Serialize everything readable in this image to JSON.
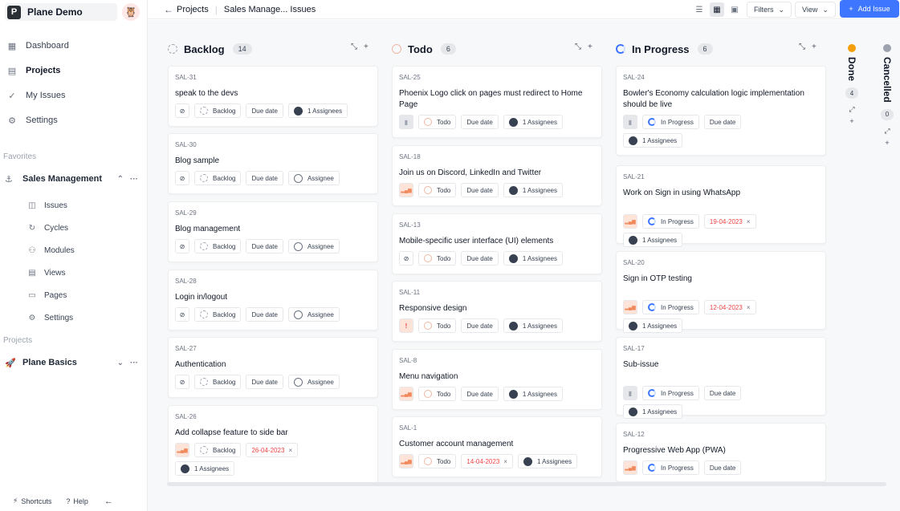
{
  "workspace": {
    "logo_letter": "P",
    "name": "Plane Demo",
    "user_avatar": "🦉"
  },
  "nav": [
    {
      "label": "Dashboard",
      "icon": "grid-icon",
      "glyph": "▦"
    },
    {
      "label": "Projects",
      "icon": "projects-icon",
      "glyph": "▤"
    },
    {
      "label": "My Issues",
      "icon": "check-circle-icon",
      "glyph": "✓"
    },
    {
      "label": "Settings",
      "icon": "gear-icon",
      "glyph": "⚙"
    }
  ],
  "favorites_label": "Favorites",
  "favorite_project": {
    "name": "Sales Management",
    "glyph": "⚓",
    "chevron": "⌃",
    "more": "···"
  },
  "sub_nav": [
    {
      "label": "Issues",
      "glyph": "◫",
      "icon": "layers-icon"
    },
    {
      "label": "Cycles",
      "glyph": "↻",
      "icon": "cycle-icon"
    },
    {
      "label": "Modules",
      "glyph": "⚇",
      "icon": "modules-icon"
    },
    {
      "label": "Views",
      "glyph": "▤",
      "icon": "views-icon"
    },
    {
      "label": "Pages",
      "glyph": "▭",
      "icon": "pages-icon"
    },
    {
      "label": "Settings",
      "glyph": "⚙",
      "icon": "gear-icon"
    }
  ],
  "projects_label": "Projects",
  "other_project": {
    "name": "Plane Basics",
    "glyph": "🚀",
    "chevron": "⌄",
    "more": "···"
  },
  "footer": {
    "shortcuts": "Shortcuts",
    "help": "Help"
  },
  "header": {
    "crumb_root": "Projects",
    "crumb_current": "Sales Manage... Issues",
    "filters": "Filters",
    "view": "View",
    "add_issue": "Add Issue"
  },
  "columns": [
    {
      "title": "Backlog",
      "count": "14",
      "color": "#c9ccd1"
    },
    {
      "title": "Todo",
      "count": "6",
      "color": "#f0b8a4"
    },
    {
      "title": "In Progress",
      "count": "6",
      "color": "#3f76ff"
    }
  ],
  "collapsed_columns": [
    {
      "title": "Done",
      "count": "4",
      "color": "#f59e0b"
    },
    {
      "title": "Cancelled",
      "count": "0",
      "color": "#9ca3af"
    }
  ],
  "cards": {
    "backlog": [
      {
        "id": "SAL-31",
        "title": "speak to the devs",
        "priority": "none",
        "state": "Backlog",
        "date": "Due date",
        "assignee": "1 Assignees"
      },
      {
        "id": "SAL-30",
        "title": "Blog sample",
        "priority": "none",
        "state": "Backlog",
        "date": "Due date",
        "assignee": "Assignee"
      },
      {
        "id": "SAL-29",
        "title": "Blog management",
        "priority": "none",
        "state": "Backlog",
        "date": "Due date",
        "assignee": "Assignee"
      },
      {
        "id": "SAL-28",
        "title": "Login in/logout",
        "priority": "none",
        "state": "Backlog",
        "date": "Due date",
        "assignee": "Assignee"
      },
      {
        "id": "SAL-27",
        "title": "Authentication",
        "priority": "none",
        "state": "Backlog",
        "date": "Due date",
        "assignee": "Assignee"
      },
      {
        "id": "SAL-26",
        "title": "Add collapse feature to side bar",
        "priority": "medium",
        "state": "Backlog",
        "date": "26-04-2023",
        "assignee": "1 Assignees"
      }
    ],
    "todo": [
      {
        "id": "SAL-25",
        "title": "Phoenix Logo click on pages must redirect to Home Page",
        "priority": "low",
        "state": "Todo",
        "date": "Due date",
        "assignee": "1 Assignees"
      },
      {
        "id": "SAL-18",
        "title": "Join us on Discord, LinkedIn and Twitter",
        "priority": "medium",
        "state": "Todo",
        "date": "Due date",
        "assignee": "1 Assignees"
      },
      {
        "id": "SAL-13",
        "title": "Mobile-specific user interface (UI) elements",
        "priority": "none",
        "state": "Todo",
        "date": "Due date",
        "assignee": "1 Assignees"
      },
      {
        "id": "SAL-11",
        "title": "Responsive design",
        "priority": "urgent",
        "state": "Todo",
        "date": "Due date",
        "assignee": "1 Assignees"
      },
      {
        "id": "SAL-8",
        "title": "Menu navigation",
        "priority": "medium",
        "state": "Todo",
        "date": "Due date",
        "assignee": "1 Assignees"
      },
      {
        "id": "SAL-1",
        "title": "Customer account management",
        "priority": "medium",
        "state": "Todo",
        "date": "14-04-2023",
        "assignee": "1 Assignees"
      }
    ],
    "inprogress": [
      {
        "id": "SAL-24",
        "title": "Bowler's Economy calculation logic implementation should be live",
        "priority": "low",
        "state": "In Progress",
        "date": "Due date",
        "assignee": "1 Assignees"
      },
      {
        "id": "SAL-21",
        "title": "Work on Sign in using WhatsApp",
        "priority": "medium",
        "state": "In Progress",
        "date": "19-04-2023",
        "assignee": "1 Assignees"
      },
      {
        "id": "SAL-20",
        "title": "Sign in OTP testing",
        "priority": "medium",
        "state": "In Progress",
        "date": "12-04-2023",
        "assignee": "1 Assignees"
      },
      {
        "id": "SAL-17",
        "title": "Sub-issue",
        "priority": "low",
        "state": "In Progress",
        "date": "Due date",
        "assignee": "1 Assignees"
      },
      {
        "id": "SAL-12",
        "title": "Progressive Web App (PWA)",
        "priority": "medium",
        "state": "In Progress",
        "date": "Due date",
        "assignee": ""
      }
    ]
  }
}
